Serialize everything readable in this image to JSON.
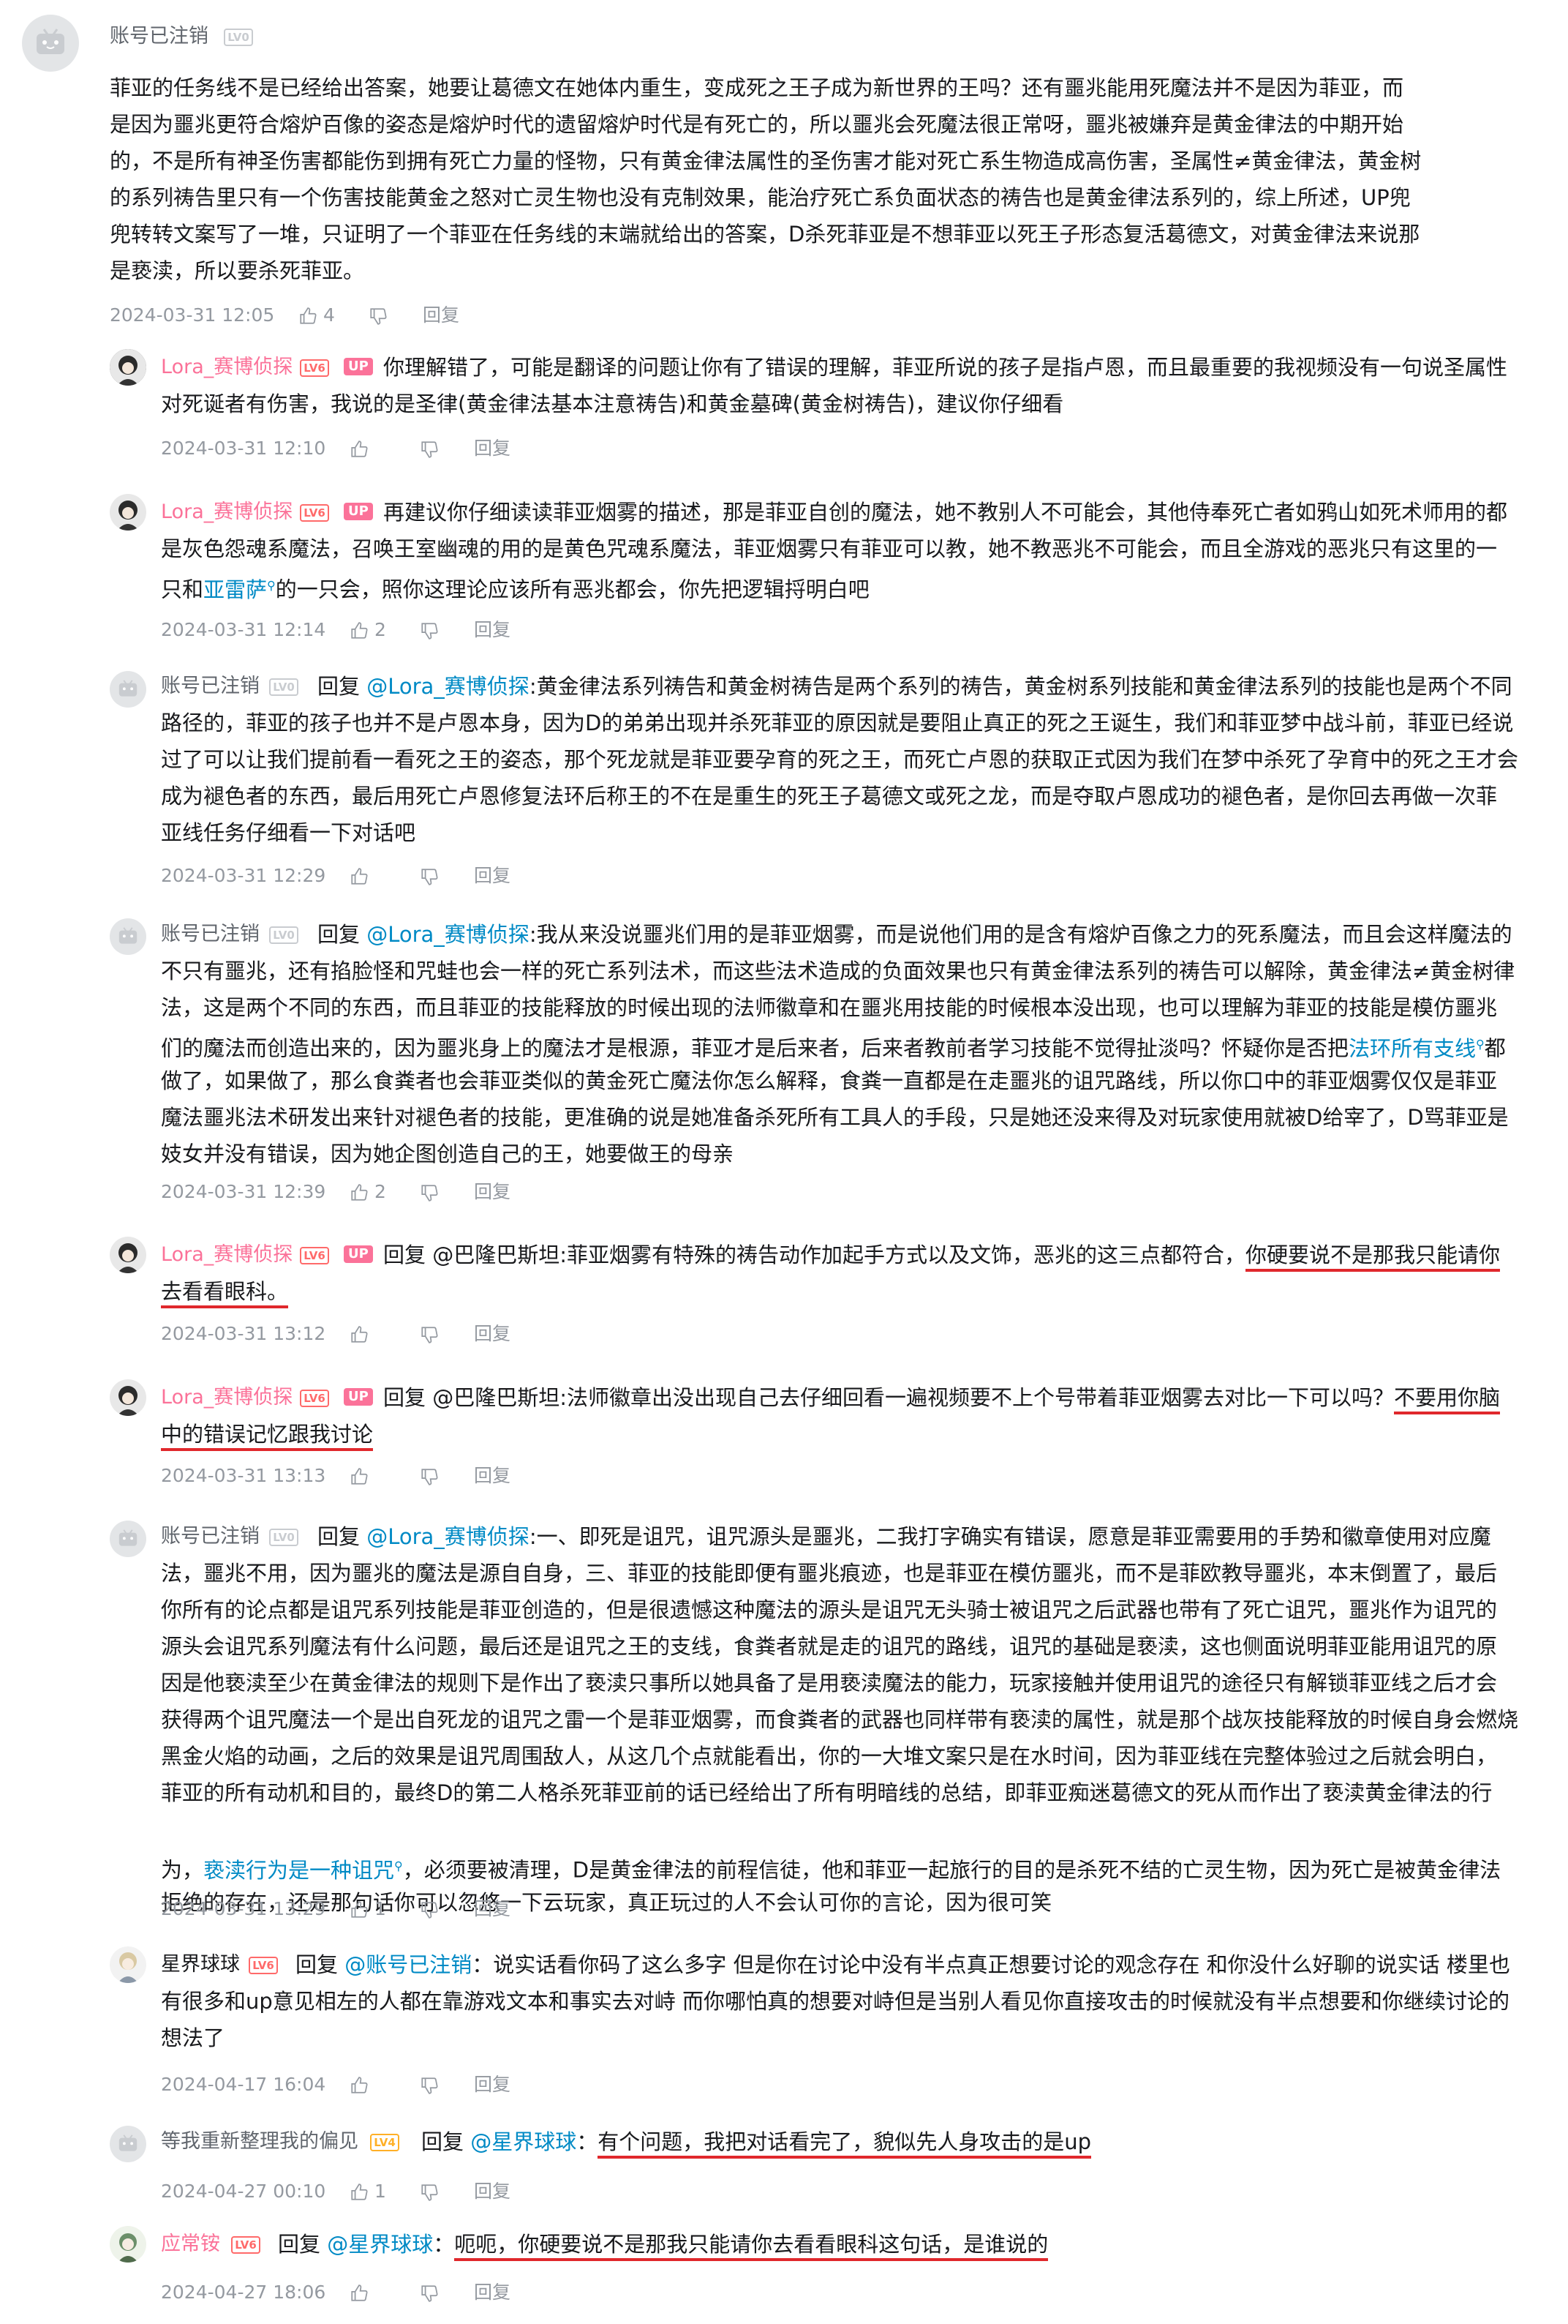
{
  "comments": [
    {
      "name": "账号已注销",
      "level": "LV0",
      "text": [
        "菲亚的任务线不是已经给出答案，她要让葛德文在她体内重生，变成死之王子成为新世界的王吗？还有噩兆能用死魔法并不是因为菲亚，而",
        "是因为噩兆更符合熔炉百像的姿态是熔炉时代的遗留熔炉时代是有死亡的，所以噩兆会死魔法很正常呀，噩兆被嫌弃是黄金律法的中期开始",
        "的，不是所有神圣伤害都能伤到拥有死亡力量的怪物，只有黄金律法属性的圣伤害才能对死亡系生物造成高伤害，圣属性≠黄金律法，黄金树",
        "的系列祷告里只有一个伤害技能黄金之怒对亡灵生物也没有克制效果，能治疗死亡系负面状态的祷告也是黄金律法系列的，综上所述，UP兜",
        "兜转转文案写了一堆，只证明了一个菲亚在任务线的末端就给出的答案，D杀死菲亚是不想菲亚以死王子形态复活葛德文，对黄金律法来说那",
        "是亵渎，所以要杀死菲亚。"
      ],
      "date": "2024-03-31 12:05",
      "likes": "4",
      "reply_label": "回复"
    },
    {
      "name": "Lora_赛博侦探",
      "level": "LV6",
      "up": "UP",
      "text": [
        "你理解错了，可能是翻译的问题让你有了错误的理解，菲亚所说的孩子是指卢恩，而且最重要的我视频没有一句说圣属性",
        "对死诞者有伤害，我说的是圣律(黄金律法基本注意祷告)和黄金墓碑(黄金树祷告)，建议你仔细看"
      ],
      "date": "2024-03-31 12:10",
      "likes": "",
      "reply_label": "回复"
    },
    {
      "name": "Lora_赛博侦探",
      "level": "LV6",
      "up": "UP",
      "text_a": "再建议你仔细读读菲亚烟雾的描述，那是菲亚自创的魔法，她不教别人不可能会，其他侍奉死亡者如鸦山如死术师用的都",
      "text_b": "是灰色怨魂系魔法，召唤王室幽魂的用的是黄色咒魂系魔法，菲亚烟雾只有菲亚可以教，她不教恶兆不可能会，而且全游戏的恶兆只有这里的一",
      "text_c1": "只和",
      "link": "亚雷萨",
      "text_c2": "的一只会，照你这理论应该所有恶兆都会，你先把逻辑捋明白吧",
      "date": "2024-03-31 12:14",
      "likes": "2",
      "reply_label": "回复"
    },
    {
      "name": "账号已注销",
      "level": "LV0",
      "reply_word": "回复 ",
      "at": "@Lora_赛博侦探",
      "first": ":黄金律法系列祷告和黄金树祷告是两个系列的祷告，黄金树系列技能和黄金律法系列的技能也是两个不同",
      "text": [
        "路径的，菲亚的孩子也并不是卢恩本身，因为D的弟弟出现并杀死菲亚的原因就是要阻止真正的死之王诞生，我们和菲亚梦中战斗前，菲亚已经说",
        "过了可以让我们提前看一看死之王的姿态，那个死龙就是菲亚要孕育的死之王，而死亡卢恩的获取正式因为我们在梦中杀死了孕育中的死之王才会",
        "成为褪色者的东西，最后用死亡卢恩修复法环后称王的不在是重生的死王子葛德文或死之龙，而是夺取卢恩成功的褪色者，是你回去再做一次菲",
        "亚线任务仔细看一下对话吧"
      ],
      "date": "2024-03-31 12:29",
      "likes": "",
      "reply_label": "回复"
    },
    {
      "name": "账号已注销",
      "level": "LV0",
      "reply_word": "回复 ",
      "at": "@Lora_赛博侦探",
      "first": ":我从来没说噩兆们用的是菲亚烟雾，而是说他们用的是含有熔炉百像之力的死系魔法，而且会这样魔法的",
      "text": [
        "不只有噩兆，还有掐脸怪和咒蛙也会一样的死亡系列法术，而这些法术造成的负面效果也只有黄金律法系列的祷告可以解除，黄金律法≠黄金树律",
        "法，这是两个不同的东西，而且菲亚的技能释放的时候出现的法师徽章和在噩兆用技能的时候根本没出现，也可以理解为菲亚的技能是模仿噩兆",
        "们的魔法而创造出来的，因为噩兆身上的魔法才是根源，菲亚才是后来者，后来者教前者学习技能不觉得扯淡吗？怀疑你是否把"
      ],
      "link": "法环所有支线",
      "after_link": "都",
      "text2": [
        "做了，如果做了，那么食粪者也会菲亚类似的黄金死亡魔法你怎么解释，食粪一直都是在走噩兆的诅咒路线，所以你口中的菲亚烟雾仅仅是菲亚",
        "魔法噩兆法术研发出来针对褪色者的技能，更准确的说是她准备杀死所有工具人的手段，只是她还没来得及对玩家使用就被D给宰了，D骂菲亚是",
        "妓女并没有错误，因为她企图创造自己的王，她要做王的母亲"
      ],
      "date": "2024-03-31 12:39",
      "likes": "2",
      "reply_label": "回复"
    },
    {
      "name": "Lora_赛博侦探",
      "level": "LV6",
      "up": "UP",
      "reply_word": "回复 ",
      "at_plain": "@巴隆巴斯坦",
      "first": ":菲亚烟雾有特殊的祷告动作加起手方式以及文饰，恶兆的这三点都符合，",
      "underlined": "你硬要说不是那我只能请你",
      "line2": "去看看眼科。",
      "date": "2024-03-31 13:12",
      "likes": "",
      "reply_label": "回复"
    },
    {
      "name": "Lora_赛博侦探",
      "level": "LV6",
      "up": "UP",
      "reply_word": "回复 ",
      "at_plain": "@巴隆巴斯坦",
      "first": ":法师徽章出没出现自己去仔细回看一遍视频要不上个号带着菲亚烟雾去对比一下可以吗？",
      "underlined": "不要用你脑",
      "line2": "中的错误记忆跟我讨论",
      "date": "2024-03-31 13:13",
      "likes": "",
      "reply_label": "回复"
    },
    {
      "name": "账号已注销",
      "level": "LV0",
      "reply_word": "回复 ",
      "at": "@Lora_赛博侦探",
      "first": ":一、即死是诅咒，诅咒源头是噩兆，二我打字确实有错误，愿意是菲亚需要用的手势和徽章使用对应魔",
      "text": [
        "法，噩兆不用，因为噩兆的魔法是源自自身，三、菲亚的技能即便有噩兆痕迹，也是菲亚在模仿噩兆，而不是菲欧教导噩兆，本末倒置了，最后",
        "你所有的论点都是诅咒系列技能是菲亚创造的，但是很遗憾这种魔法的源头是诅咒无头骑士被诅咒之后武器也带有了死亡诅咒，噩兆作为诅咒的",
        "源头会诅咒系列魔法有什么问题，最后还是诅咒之王的支线，食粪者就是走的诅咒的路线，诅咒的基础是亵渎，这也侧面说明菲亚能用诅咒的原",
        "因是他亵渎至少在黄金律法的规则下是作出了亵渎只事所以她具备了是用亵渎魔法的能力，玩家接触并使用诅咒的途径只有解锁菲亚线之后才会",
        "获得两个诅咒魔法一个是出自死龙的诅咒之雷一个是菲亚烟雾，而食粪者的武器也同样带有亵渎的属性，就是那个战灰技能释放的时候自身会燃烧",
        "黑金火焰的动画，之后的效果是诅咒周围敌人，从这几个点就能看出，你的一大堆文案只是在水时间，因为菲亚线在完整体验过之后就会明白，",
        "菲亚的所有动机和目的，最终D的第二人格杀死菲亚前的话已经给出了所有明暗线的总结，即菲亚痴迷葛德文的死从而作出了亵渎黄金律法的行"
      ],
      "pre_link": "为，",
      "link": "亵渎行为是一种诅咒",
      "after_link": "，必须要被清理，D是黄金律法的前程信徒，他和菲亚一起旅行的目的是杀死不结的亡灵生物，因为死亡是被黄金律法",
      "last": "拒绝的存在，还是那句话你可以忽悠一下云玩家，真正玩过的人不会认可你的言论，因为很可笑",
      "date": "2024-03-31 13:29",
      "likes": "1",
      "reply_label": "回复"
    },
    {
      "name": "星界球球",
      "level": "LV6",
      "reply_word": "回复 ",
      "at": "@账号已注销",
      "first": "：说实话看你码了这么多字 但是你在讨论中没有半点真正想要讨论的观念存在 和你没什么好聊的说实话 楼里也",
      "text": [
        "有很多和up意见相左的人都在靠游戏文本和事实去对峙 而你哪怕真的想要对峙但是当别人看见你直接攻击的时候就没有半点想要和你继续讨论的",
        "想法了"
      ],
      "date": "2024-04-17 16:04",
      "likes": "",
      "reply_label": "回复"
    },
    {
      "name": "等我重新整理我的偏见",
      "level": "LV4",
      "reply_word": "回复 ",
      "at": "@星界球球",
      "colon": "：",
      "underlined": "有个问题，我把对话看完了，貌似先人身攻击的是up",
      "date": "2024-04-27 00:10",
      "likes": "1",
      "reply_label": "回复"
    },
    {
      "name": "应常铵",
      "level": "LV6",
      "reply_word": "回复 ",
      "at": "@星界球球",
      "colon": "：",
      "underlined": "呃呃，你硬要说不是那我只能请你去看看眼科这句话，是谁说的",
      "date": "2024-04-27 18:06",
      "likes": "",
      "reply_label": "回复"
    }
  ]
}
